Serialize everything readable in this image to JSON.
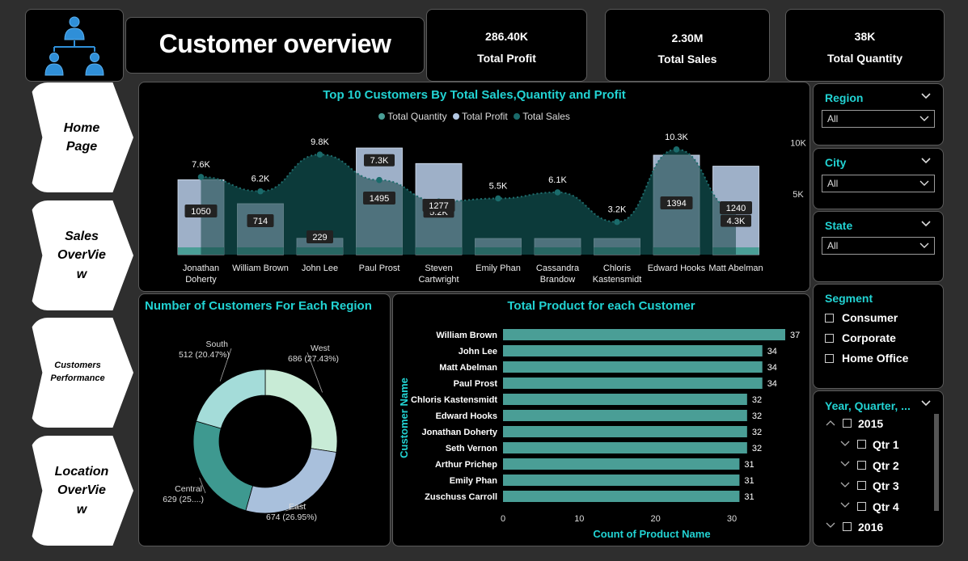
{
  "header": {
    "title": "Customer overview",
    "kpis": [
      {
        "value": "286.40K",
        "label": "Total Profit"
      },
      {
        "value": "2.30M",
        "label": "Total Sales"
      },
      {
        "value": "38K",
        "label": "Total Quantity"
      }
    ]
  },
  "nav": {
    "home": [
      "Home",
      "Page"
    ],
    "sales": [
      "Sales",
      "OverVie",
      "w"
    ],
    "customers": [
      "Customers",
      "Performance"
    ],
    "location": [
      "Location",
      "OverVie",
      "w"
    ]
  },
  "colors": {
    "accent": "#22d3d3",
    "profit_bar": "#b4c8e4",
    "quantity_bar": "#4a9e96",
    "sales_area": "#0c3a3a",
    "donut": [
      "#c8ebd6",
      "#a9c0dc",
      "#3e9990",
      "#a4dcd9"
    ],
    "bar": "#4a9e96"
  },
  "chart_data": [
    {
      "type": "combo",
      "title": "Top 10 Customers By Total Sales,Quantity and Profit",
      "legend": [
        "Total Quantity",
        "Total Profit",
        "Total Sales"
      ],
      "legend_position": "top-center",
      "categories": [
        [
          "Jonathan",
          "Doherty"
        ],
        [
          "William Brown"
        ],
        [
          "John Lee"
        ],
        [
          "Paul Prost"
        ],
        [
          "Steven",
          "Cartwright"
        ],
        [
          "Emily Phan"
        ],
        [
          "Cassandra",
          "Brandow"
        ],
        [
          "Chloris",
          "Kastensmidt"
        ],
        [
          "Edward Hooks"
        ],
        [
          "Matt Abelman"
        ]
      ],
      "series": [
        {
          "name": "Total Profit",
          "values": [
            1050,
            714,
            229,
            1495,
            1277,
            0,
            0,
            0,
            1394,
            1240
          ],
          "value_labels": [
            "1050",
            "714",
            "229",
            "1495",
            "1277",
            "",
            "",
            "",
            "1394",
            "1240"
          ]
        },
        {
          "name": "Total Quantity",
          "values": [
            150,
            150,
            150,
            150,
            150,
            150,
            150,
            150,
            150,
            150
          ]
        },
        {
          "name": "Total Sales",
          "values": [
            7600,
            6200,
            9800,
            7300,
            5200,
            5500,
            6100,
            3200,
            10300,
            4300
          ],
          "value_labels": [
            "7.6K",
            "6.2K",
            "9.8K",
            "7.3K",
            "5.2K",
            "5.5K",
            "6.1K",
            "3.2K",
            "10.3K",
            "4.3K"
          ]
        }
      ],
      "y_ticks": [
        "10K",
        "5K"
      ],
      "y_tick_values": [
        10000,
        5000
      ]
    },
    {
      "type": "pie",
      "title": "Number of Customers For Each Region",
      "slices": [
        {
          "name": "West",
          "value": 686,
          "label": "686 (27.43%)"
        },
        {
          "name": "East",
          "value": 674,
          "label": "674 (26.95%)"
        },
        {
          "name": "Central",
          "value": 629,
          "label": "629 (25....)"
        },
        {
          "name": "South",
          "value": 512,
          "label": "512 (20.47%)"
        }
      ]
    },
    {
      "type": "bar",
      "title": "Total Product for each Customer",
      "xlabel": "Count of Product Name",
      "ylabel": "Customer Name",
      "xlim": [
        0,
        37
      ],
      "x_ticks": [
        "0",
        "10",
        "20",
        "30"
      ],
      "categories": [
        "William Brown",
        "John Lee",
        "Matt Abelman",
        "Paul Prost",
        "Chloris Kastensmidt",
        "Edward Hooks",
        "Jonathan Doherty",
        "Seth Vernon",
        "Arthur Prichep",
        "Emily Phan",
        "Zuschuss Carroll"
      ],
      "values": [
        37,
        34,
        34,
        34,
        32,
        32,
        32,
        32,
        31,
        31,
        31
      ]
    }
  ],
  "slicers": {
    "region": {
      "title": "Region",
      "value": "All"
    },
    "city": {
      "title": "City",
      "value": "All"
    },
    "state": {
      "title": "State",
      "value": "All"
    },
    "segment": {
      "title": "Segment",
      "options": [
        "Consumer",
        "Corporate",
        "Home Office"
      ]
    },
    "date": {
      "title": "Year, Quarter, ...",
      "items": [
        "2015",
        "Qtr 1",
        "Qtr 2",
        "Qtr 3",
        "Qtr 4",
        "2016"
      ]
    }
  }
}
